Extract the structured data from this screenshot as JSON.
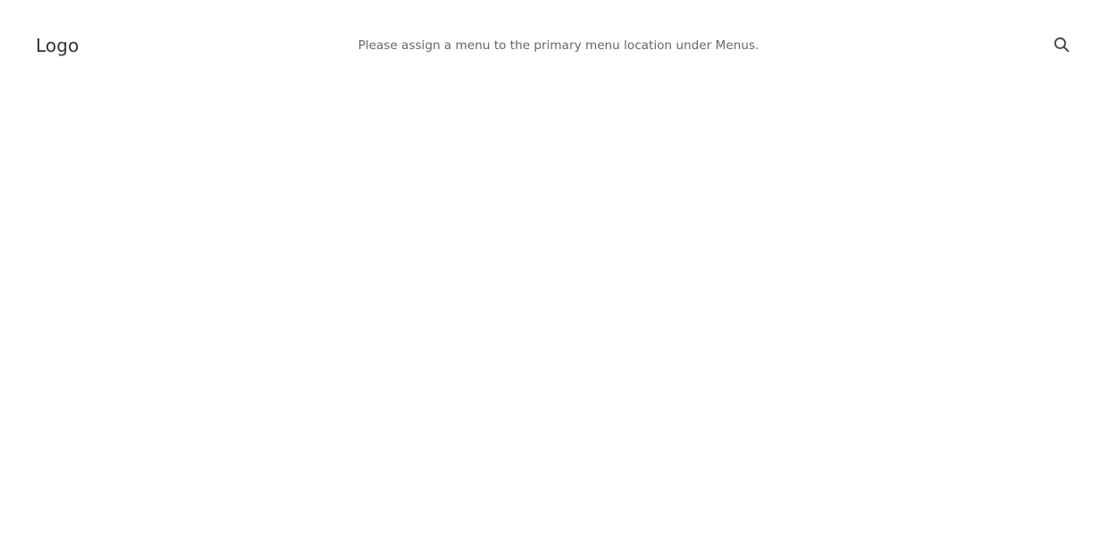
{
  "header": {
    "logo_text": "Logo",
    "menu_notice": {
      "text_before": "Please assign a menu to the primary menu location under ",
      "link_text": "Menus",
      "text_after": "."
    },
    "search_icon": "search-icon"
  },
  "colors": {
    "background": "#ffffff",
    "logo": "#333333",
    "notice_text": "#666666",
    "icon": "#444444"
  }
}
